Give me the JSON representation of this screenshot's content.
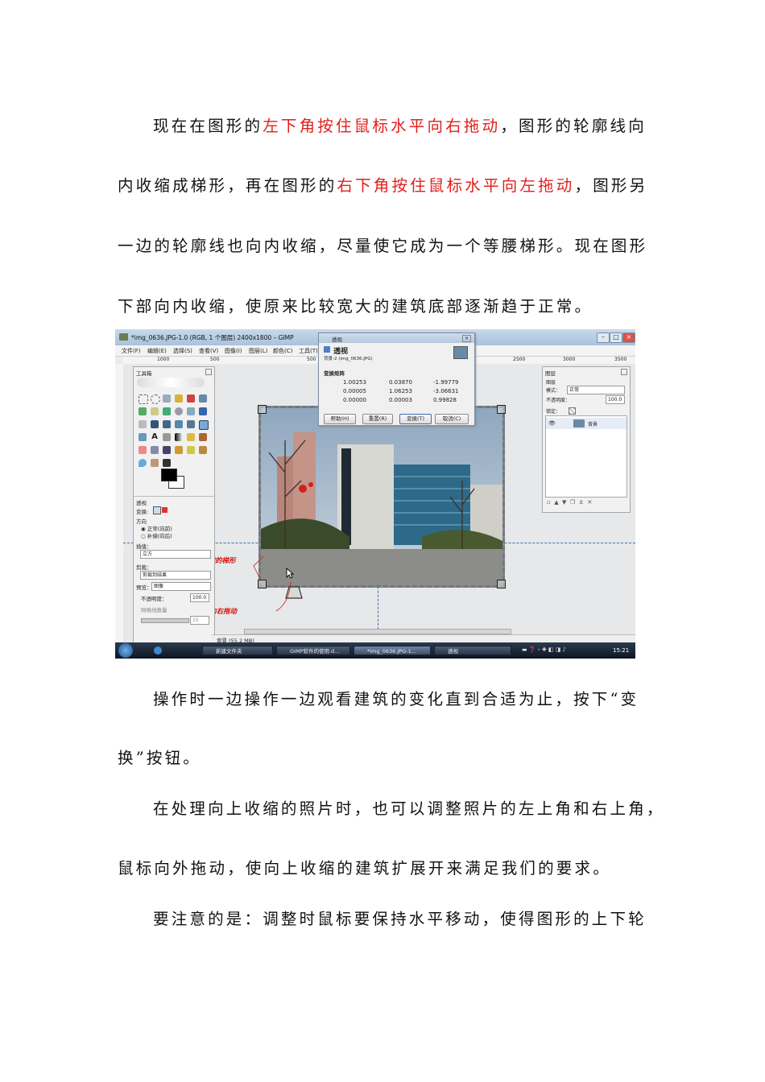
{
  "paragraphs": {
    "p1_l1_a": "现在在图形的",
    "p1_l1_red": "左下角按住鼠标水平向右拖动",
    "p1_l1_b": "，图形的轮廓线向",
    "p1_l2_a": "内收缩成梯形，再在图形的",
    "p1_l2_red": "右下角按住鼠标水平向左拖动",
    "p1_l2_b": "，图形另",
    "p1_l3": "一边的轮廓线也向内收缩，尽量使它成为一个等腰梯形。现在图形",
    "p1_l4": "下部向内收缩，使原来比较宽大的建筑底部逐渐趋于正常。",
    "p2_l1": "操作时一边操作一边观看建筑的变化直到合适为止，按下“变",
    "p2_l2": "换”按钮。",
    "p3_l1": "在处理向上收缩的照片时，也可以调整照片的左上角和右上角，",
    "p3_l2": "鼠标向外拖动，使向上收缩的建筑扩展开来满足我们的要求。",
    "p4_l1": "要注意的是：调整时鼠标要保持水平移动，使得图形的上下轮"
  },
  "screenshot": {
    "window_title": "*img_0636.JPG-1.0 (RGB, 1 个图层) 2400x1800 – GIMP",
    "menu": [
      "文件(F)",
      "编辑(E)",
      "选择(S)",
      "查看(V)",
      "图像(I)",
      "图层(L)",
      "颜色(C)",
      "工具(T)"
    ],
    "ruler_ticks": [
      "1000",
      "500",
      "500",
      "2500",
      "3000",
      "3500"
    ],
    "toolbox": {
      "title": "工具箱",
      "options_title": "透视",
      "transform_label": "变换:",
      "direction_label": "方向",
      "dir_forward": "正常(向前)",
      "dir_backward": "补偿(向后)",
      "interp_label": "插值：",
      "interp_value": "立方",
      "clip_label": "剪裁：",
      "clip_value": "剪裁到结果",
      "preview_label": "预览：",
      "preview_value": "图像",
      "opacity_label": "不透明度：",
      "opacity_value": "100.0",
      "grid_label": "网格线数量",
      "grid_value": "15"
    },
    "dialog": {
      "title": "透视",
      "heading": "透视",
      "subheading": "背景-2 (img_0636.JPG)",
      "matrix_label": "变换矩阵",
      "matrix": [
        [
          "1.00253",
          "0.03870",
          "-1.99779"
        ],
        [
          "0.00005",
          "1.06253",
          "-3.06631"
        ],
        [
          "0.00000",
          "0.00003",
          "0.99828"
        ]
      ],
      "btn_help": "帮助(H)",
      "btn_reset": "重置(R)",
      "btn_transform": "变换(T)",
      "btn_cancel": "取消(C)"
    },
    "layers": {
      "title": "图层",
      "subtitle": "图层",
      "mode_label": "模式：",
      "mode_value": "正常",
      "opacity_label": "不透明度：",
      "opacity_value": "100.0",
      "lock_label": "锁定：",
      "layer_name": "背景"
    },
    "annotations": {
      "shrink": "收缩的梯形",
      "drag": "按住鼠标向右拖动"
    },
    "status": "背景 (55.2 MB)",
    "taskbar": {
      "items": [
        "新建文件夹",
        "GIMP软件的使用.d...",
        "*img_0636.JPG-1...",
        "透视"
      ],
      "clock": "15:21"
    }
  }
}
